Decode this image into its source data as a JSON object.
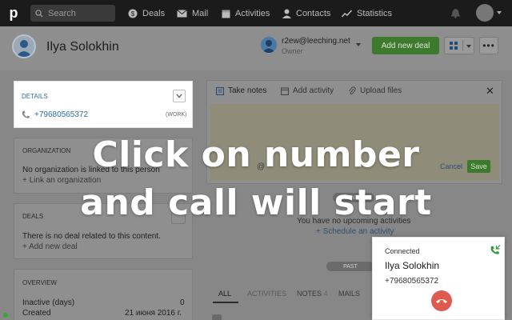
{
  "nav": {
    "logo": "p",
    "search_placeholder": "Search",
    "items": [
      "Deals",
      "Mail",
      "Activities",
      "Contacts",
      "Statistics"
    ]
  },
  "person": {
    "name": "Ilya Solokhin"
  },
  "owner": {
    "email": "r2ew@leeching.net",
    "role": "Owner"
  },
  "header": {
    "add_deal_label": "Add new deal",
    "more_label": "•••"
  },
  "details": {
    "title": "DETAILS",
    "phone": "+79680565372",
    "phone_type": "(WORK)"
  },
  "organization": {
    "title": "ORGANIZATION",
    "text": "No organization is linked to this person",
    "link": "+ Link an organization"
  },
  "deals": {
    "title": "DEALS",
    "text": "There is no deal related to this content.",
    "link": "+ Add new deal"
  },
  "overview": {
    "title": "OVERVIEW",
    "rows": [
      {
        "label": "Inactive (days)",
        "value": "0"
      },
      {
        "label": "Created",
        "value": "21 июня 2016 г."
      }
    ]
  },
  "notes": {
    "tabs": [
      "Take notes",
      "Add activity",
      "Upload files"
    ],
    "close": "✕",
    "cancel": "Cancel",
    "save": "Save",
    "mention": "@"
  },
  "timeline": {
    "planned": "PLANNED",
    "planned_text": "You have no upcoming activities",
    "schedule_link": "+ Schedule an activity",
    "past": "PAST",
    "tabs": [
      {
        "label": "ALL"
      },
      {
        "label": "ACTIVITIES"
      },
      {
        "label": "NOTES",
        "count": "4"
      },
      {
        "label": "MAILS"
      }
    ]
  },
  "overlay": {
    "line1": "Click on number",
    "line2": "and call will start"
  },
  "call": {
    "status": "Connected",
    "name": "Ilya Solokhin",
    "number": "+79680565372"
  },
  "colors": {
    "accent_green": "#3d7a2e",
    "link_blue": "#2d6ca2",
    "hangup_red": "#e05a4f",
    "call_icon_green": "#2f9a3a"
  }
}
